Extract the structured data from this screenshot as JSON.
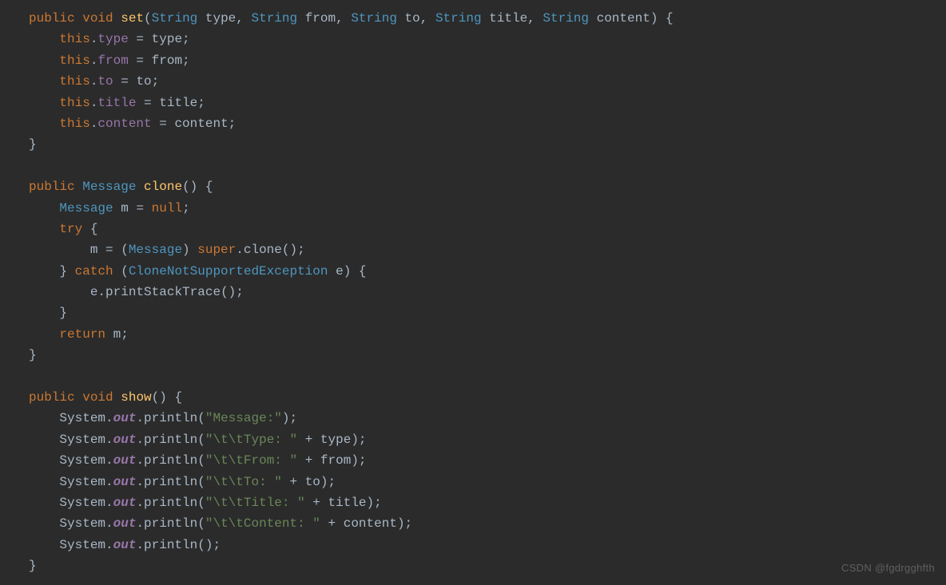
{
  "watermark": "CSDN @fgdrgghfth",
  "code": {
    "method_set": {
      "modifiers": "public void",
      "name": "set",
      "params": [
        {
          "type": "String",
          "name": "type"
        },
        {
          "type": "String",
          "name": "from"
        },
        {
          "type": "String",
          "name": "to"
        },
        {
          "type": "String",
          "name": "title"
        },
        {
          "type": "String",
          "name": "content"
        }
      ],
      "body": [
        "this.type = type;",
        "this.from = from;",
        "this.to = to;",
        "this.title = title;",
        "this.content = content;"
      ]
    },
    "method_clone": {
      "modifiers": "public",
      "return_type": "Message",
      "name": "clone",
      "body": {
        "decl": "Message m = null;",
        "try_line": "m = (Message) super.clone();",
        "catch_type": "CloneNotSupportedException",
        "catch_var": "e",
        "catch_body": "e.printStackTrace();",
        "return": "return m;"
      }
    },
    "method_show": {
      "modifiers": "public void",
      "name": "show",
      "prints": [
        {
          "literal": "\"Message:\"",
          "plus": null
        },
        {
          "literal": "\"\\t\\tType: \"",
          "plus": "type"
        },
        {
          "literal": "\"\\t\\tFrom: \"",
          "plus": "from"
        },
        {
          "literal": "\"\\t\\tTo: \"",
          "plus": "to"
        },
        {
          "literal": "\"\\t\\tTitle: \"",
          "plus": "title"
        },
        {
          "literal": "\"\\t\\tContent: \"",
          "plus": "content"
        },
        {
          "literal": null,
          "plus": null
        }
      ]
    }
  },
  "tok": {
    "kw_public": "public",
    "kw_void": "void",
    "kw_this": "this",
    "kw_null": "null",
    "kw_try": "try",
    "kw_catch": "catch",
    "kw_return": "return",
    "kw_super": "super",
    "ty_string": "String",
    "ty_message": "Message",
    "ty_cnse": "CloneNotSupportedException",
    "mth_set": "set",
    "mth_clone": "clone",
    "mth_show": "show",
    "mth_println": "println",
    "mth_pst": "printStackTrace",
    "id_system": "System",
    "id_out": "out",
    "id_type": "type",
    "id_from": "from",
    "id_to": "to",
    "id_title": "title",
    "id_content": "content",
    "id_m": "m",
    "id_e": "e",
    "str_message": "\"Message:\"",
    "str_type": "\"\\t\\tType: \"",
    "str_from": "\"\\t\\tFrom: \"",
    "str_to": "\"\\t\\tTo: \"",
    "str_title": "\"\\t\\tTitle: \"",
    "str_content": "\"\\t\\tContent: \""
  }
}
